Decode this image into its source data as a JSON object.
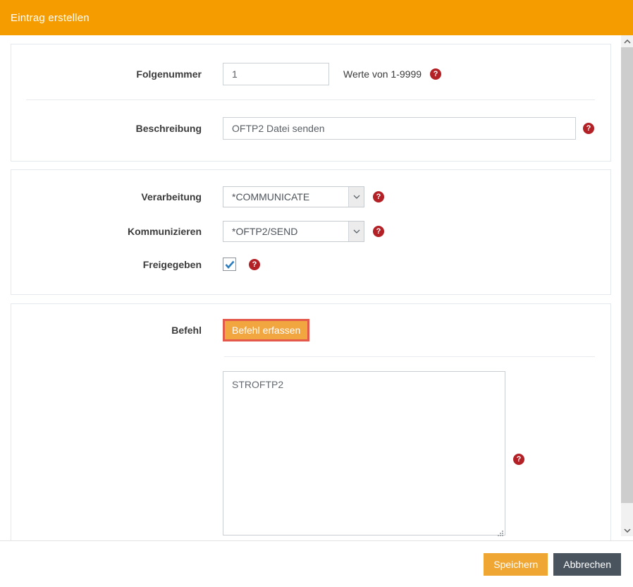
{
  "header": {
    "title": "Eintrag erstellen"
  },
  "form": {
    "folgenummer": {
      "label": "Folgenummer",
      "value": "1",
      "hint": "Werte von 1-9999"
    },
    "beschreibung": {
      "label": "Beschreibung",
      "value": "OFTP2 Datei senden"
    },
    "verarbeitung": {
      "label": "Verarbeitung",
      "value": "*COMMUNICATE"
    },
    "kommunizieren": {
      "label": "Kommunizieren",
      "value": "*OFTP2/SEND"
    },
    "freigegeben": {
      "label": "Freigegeben",
      "checked": true
    },
    "befehl": {
      "label": "Befehl",
      "button_label": "Befehl erfassen",
      "command": "STROFTP2"
    }
  },
  "footer": {
    "save_label": "Speichern",
    "cancel_label": "Abbrechen"
  },
  "icons": {
    "help_glyph": "?"
  },
  "colors": {
    "header_bg": "#f59c00",
    "save_button": "#f0a632",
    "cancel_button": "#4a545e",
    "help_icon": "#b32025",
    "befehl_button_bg": "#f2a63f",
    "befehl_button_border": "#e4584b",
    "checkbox_check": "#2d7dbe"
  }
}
